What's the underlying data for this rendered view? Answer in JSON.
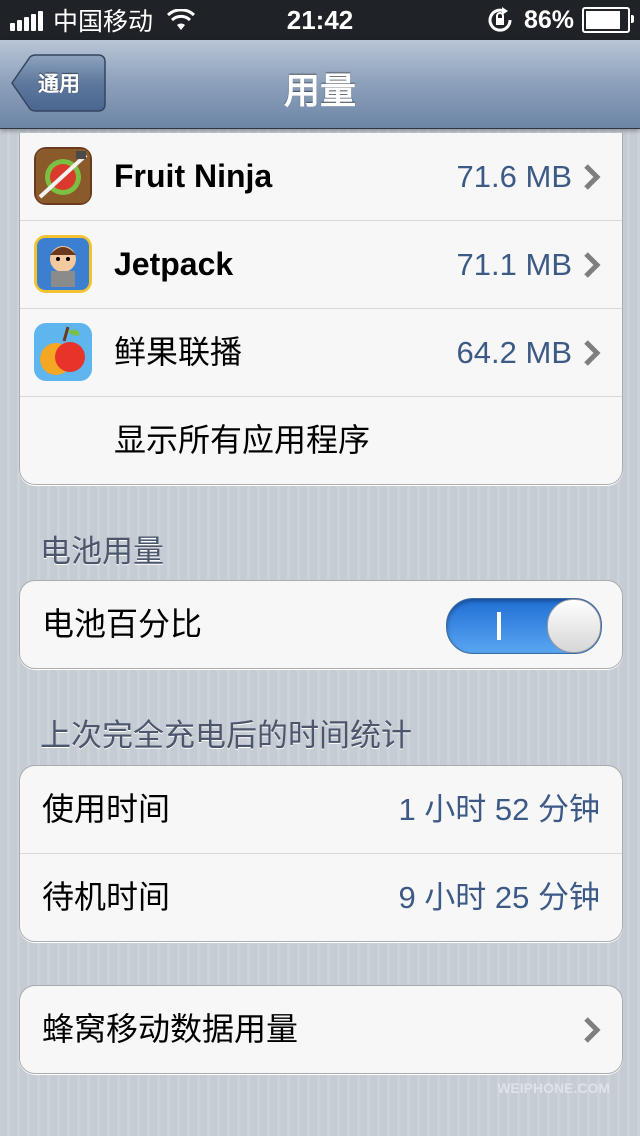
{
  "status_bar": {
    "carrier": "中国移动",
    "time": "21:42",
    "battery_percent": "86%",
    "battery_level": 0.86,
    "signal_bars": 5
  },
  "nav": {
    "back_label": "通用",
    "title": "用量"
  },
  "storage": {
    "apps": [
      {
        "name": "Fruit Ninja",
        "size": "71.6 MB",
        "icon": "fruit-ninja-icon"
      },
      {
        "name": "Jetpack",
        "size": "71.1 MB",
        "icon": "jetpack-icon"
      },
      {
        "name": "鲜果联播",
        "size": "64.2 MB",
        "icon": "xianguo-icon"
      }
    ],
    "show_all_label": "显示所有应用程序"
  },
  "battery_usage": {
    "header": "电池用量",
    "percentage_label": "电池百分比",
    "percentage_on": true
  },
  "time_stats": {
    "header": "上次完全充电后的时间统计",
    "usage_label": "使用时间",
    "usage_value": "1 小时 52 分钟",
    "standby_label": "待机时间",
    "standby_value": "9 小时 25 分钟"
  },
  "cellular": {
    "label": "蜂窝移动数据用量"
  },
  "watermark": {
    "text": "WEIPHONE.COM"
  },
  "colors": {
    "value_blue": "#3d5a86",
    "toggle_on": "#1f6fd4",
    "nav_bar": "#6d86a6"
  }
}
